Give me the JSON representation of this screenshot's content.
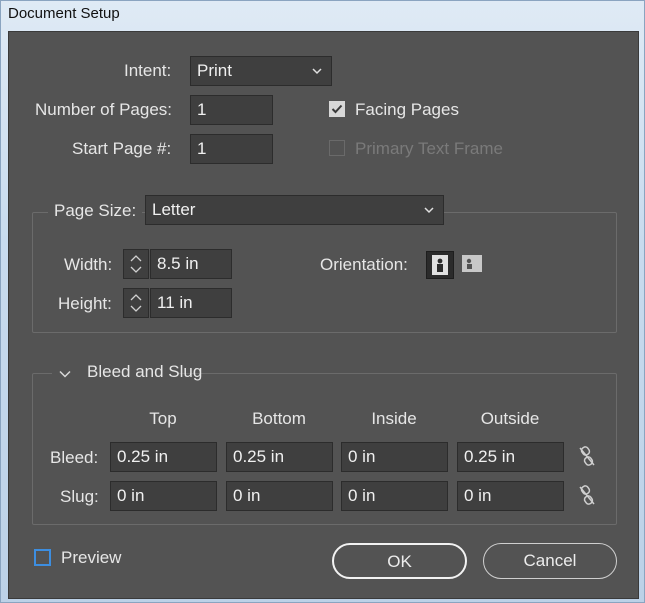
{
  "window": {
    "title": "Document Setup"
  },
  "intent": {
    "label": "Intent:",
    "value": "Print"
  },
  "pages": {
    "label": "Number of Pages:",
    "value": "1"
  },
  "start_page": {
    "label": "Start Page #:",
    "value": "1"
  },
  "facing_pages": {
    "label": "Facing Pages",
    "checked": true
  },
  "primary_text_frame": {
    "label": "Primary Text Frame",
    "checked": false,
    "disabled": true
  },
  "page_size": {
    "label": "Page Size:",
    "value": "Letter",
    "width_label": "Width:",
    "width": "8.5 in",
    "height_label": "Height:",
    "height": "11 in",
    "orientation_label": "Orientation:",
    "orientation": "portrait"
  },
  "bleed_slug": {
    "title": "Bleed and Slug",
    "columns": [
      "Top",
      "Bottom",
      "Inside",
      "Outside"
    ],
    "bleed_label": "Bleed:",
    "bleed": [
      "0.25 in",
      "0.25 in",
      "0 in",
      "0.25 in"
    ],
    "slug_label": "Slug:",
    "slug": [
      "0 in",
      "0 in",
      "0 in",
      "0 in"
    ]
  },
  "preview": {
    "label": "Preview",
    "checked": false
  },
  "buttons": {
    "ok": "OK",
    "cancel": "Cancel"
  },
  "colors": {
    "panel": "#535353",
    "field": "#3f3f3f",
    "focus": "#3d8ee0"
  }
}
